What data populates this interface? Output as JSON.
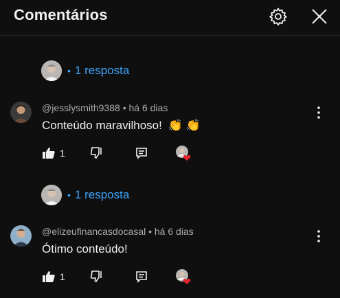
{
  "header": {
    "title": "Comentários",
    "icons": [
      "gear-icon",
      "close-icon"
    ]
  },
  "threads": [
    {
      "replies_label": "1 resposta",
      "comment": {
        "author": "@jesslysmith9388",
        "time": "há 6 dias",
        "text": "Conteúdo maravilhoso!",
        "emojis": "👏 👏",
        "likes": "1"
      }
    },
    {
      "replies_label": "1 resposta",
      "comment": {
        "author": "@elizeufinancasdocasal",
        "time": "há 6 dias",
        "text": "Ótimo conteúdo!",
        "likes": "1"
      }
    }
  ],
  "colors": {
    "background": "#0f0f0f",
    "link_blue": "#3ea6ff",
    "meta_gray": "#aaaaaa",
    "heart_red": "#e3232c"
  },
  "separator": "•"
}
